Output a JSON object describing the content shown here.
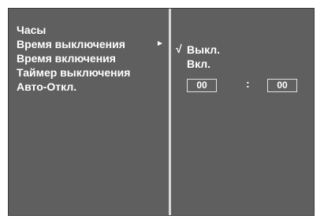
{
  "menu": {
    "items": [
      {
        "label": "Часы"
      },
      {
        "label": "Время выключения",
        "arrow": "►"
      },
      {
        "label": "Время включения"
      },
      {
        "label": "Таймер выключения"
      },
      {
        "label": "Авто-Откл."
      }
    ]
  },
  "submenu": {
    "check_mark": "√",
    "options": [
      {
        "label": "Выкл.",
        "selected": true
      },
      {
        "label": "Вкл.",
        "selected": false
      }
    ]
  },
  "time": {
    "hours": "00",
    "separator": ":",
    "minutes": "00"
  }
}
